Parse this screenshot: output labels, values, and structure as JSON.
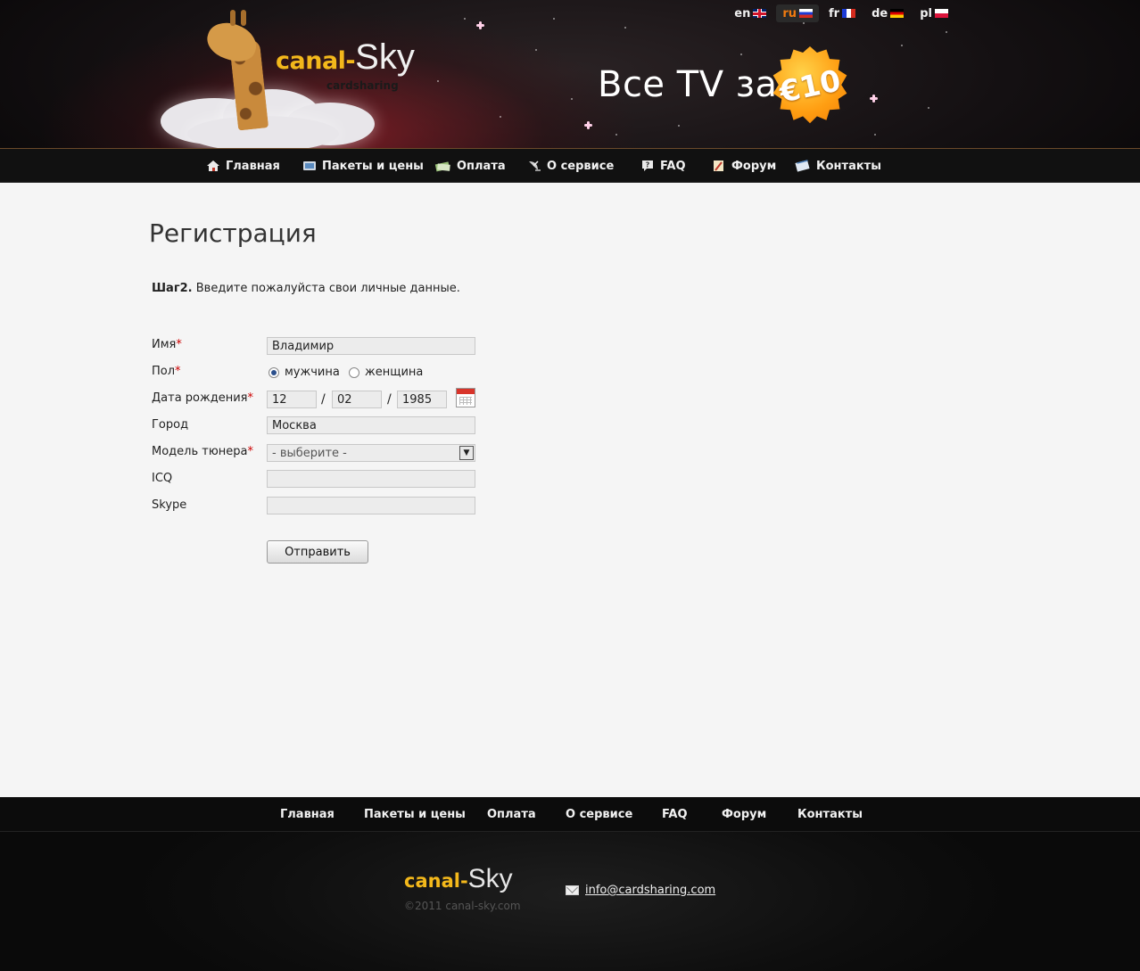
{
  "header": {
    "logo": {
      "canal": "canal-",
      "sky": "Sky",
      "sub": "cardsharing"
    },
    "languages": [
      {
        "code": "en",
        "flag": "flag-uk-icon",
        "active": false
      },
      {
        "code": "ru",
        "flag": "flag-ru-icon",
        "active": true
      },
      {
        "code": "fr",
        "flag": "flag-fr-icon",
        "active": false
      },
      {
        "code": "de",
        "flag": "flag-de-icon",
        "active": false
      },
      {
        "code": "pl",
        "flag": "flag-pl-icon",
        "active": false
      }
    ],
    "promo": "Все TV за",
    "price_badge": "€10",
    "active_language_color": "#f07a10",
    "accent_color": "#f3b81b"
  },
  "nav": {
    "items": [
      {
        "label": "Главная",
        "icon": "home-icon"
      },
      {
        "label": "Пакеты и цены",
        "icon": "tv-icon"
      },
      {
        "label": "Оплата",
        "icon": "money-icon"
      },
      {
        "label": "О сервисе",
        "icon": "satellite-icon"
      },
      {
        "label": "FAQ",
        "icon": "question-icon"
      },
      {
        "label": "Форум",
        "icon": "forum-icon"
      },
      {
        "label": "Контакты",
        "icon": "contacts-icon"
      }
    ]
  },
  "main": {
    "title": "Регистрация",
    "step_prefix": "Шаг2.",
    "step_text": "Введите пожалуйста свои личные данные.",
    "required_mark": "*",
    "form": {
      "name": {
        "label": "Имя",
        "value": "Владимир",
        "required": true
      },
      "gender": {
        "label": "Пол",
        "required": true,
        "options": [
          "мужчина",
          "женщина"
        ],
        "selected": "мужчина"
      },
      "birthdate": {
        "label": "Дата рождения",
        "required": true,
        "day": "12",
        "month": "02",
        "year": "1985",
        "separator": "/"
      },
      "city": {
        "label": "Город",
        "value": "Москва",
        "required": false
      },
      "tuner": {
        "label": "Модель тюнера",
        "required": true,
        "selected": "- выберите -"
      },
      "icq": {
        "label": "ICQ",
        "value": ""
      },
      "skype": {
        "label": "Skype",
        "value": ""
      },
      "submit": "Отправить"
    }
  },
  "footer": {
    "nav": [
      "Главная",
      "Пакеты и цены",
      "Оплата",
      "О сервисе",
      "FAQ",
      "Форум",
      "Контакты"
    ],
    "logo": {
      "canal": "canal-",
      "sky": "Sky"
    },
    "copyright": "©2011 canal-sky.com",
    "email": "info@cardsharing.com"
  }
}
